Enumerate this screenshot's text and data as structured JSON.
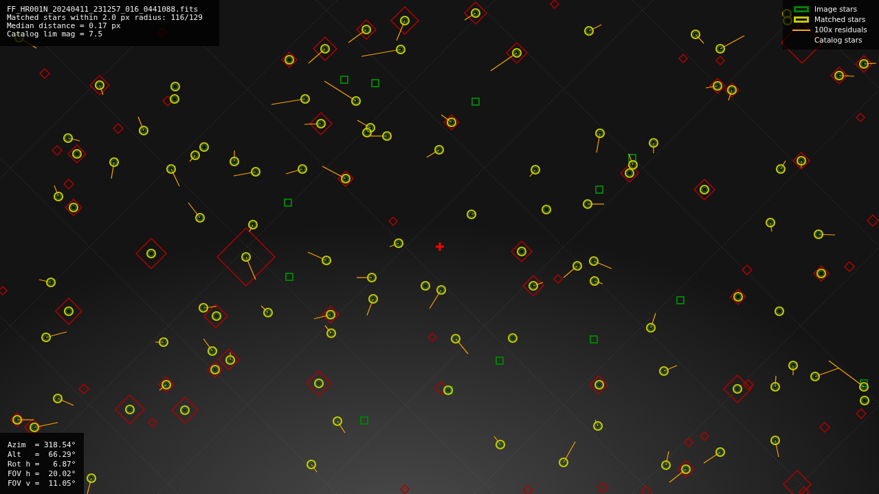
{
  "info_lines": [
    "FF_HR001N_20240411_231257_016_0441088.fits",
    "Matched stars within 2.0 px radius: 116/129",
    "Median distance = 0.17 px",
    "Catalog lim mag = 7.5"
  ],
  "legend": [
    {
      "kind": "box",
      "color": "#008000",
      "label": "Image stars"
    },
    {
      "kind": "box",
      "color": "#c8c800",
      "label": "Matched stars"
    },
    {
      "kind": "line",
      "color": "#ffa500",
      "label": "100x residuals"
    },
    {
      "kind": "none",
      "label": "Catalog stars"
    }
  ],
  "pointing_lines": [
    "Azim  = 318.54°",
    "Alt   =  66.29°",
    "Rot h =   6.87°",
    "FOV h =  20.02°",
    "FOV v =  11.05°"
  ]
}
